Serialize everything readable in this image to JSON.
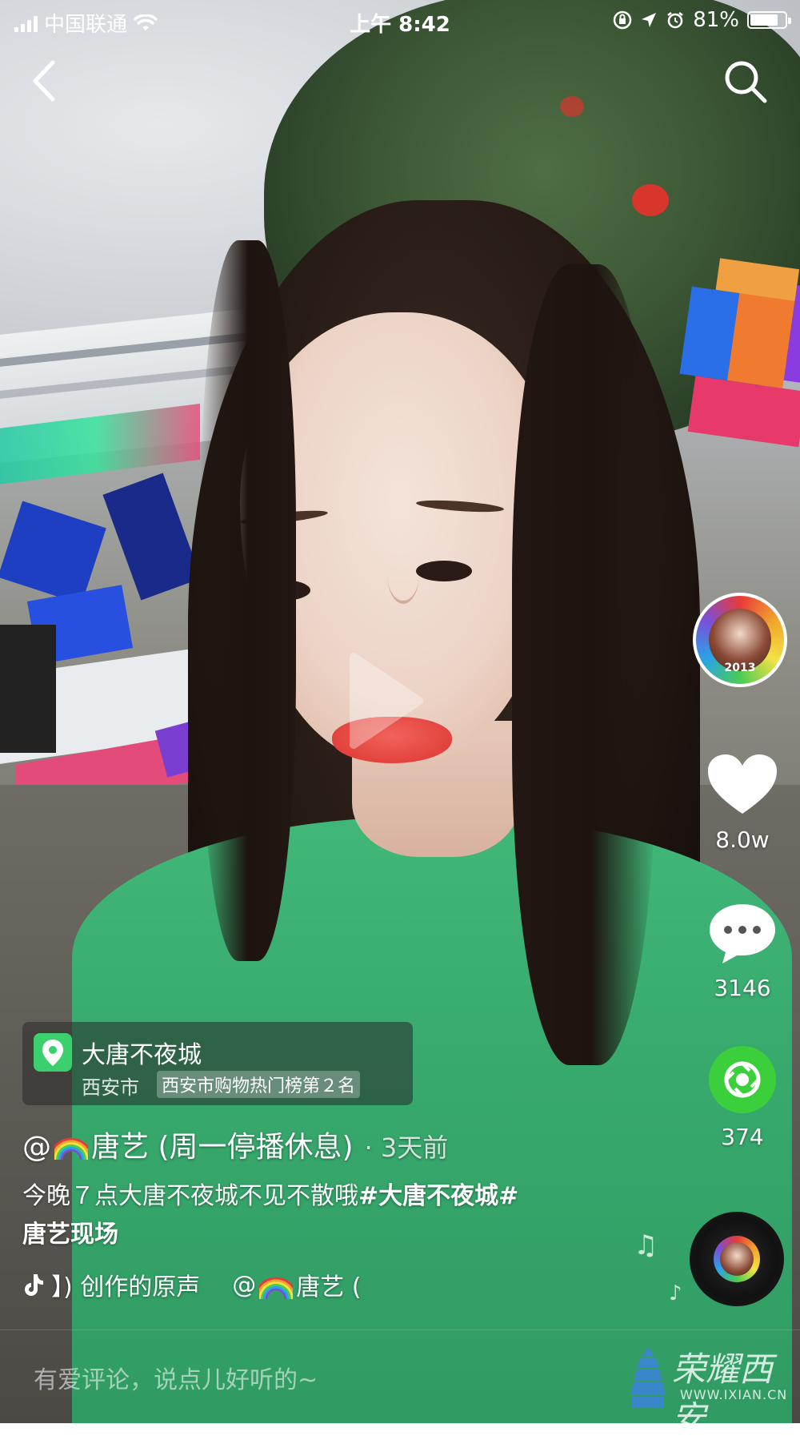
{
  "status_bar": {
    "carrier": "中国联通",
    "time": "上午 8:42",
    "battery_percent": "81%",
    "battery_level": 0.81
  },
  "nav": {
    "back_icon": "chevron-left-icon",
    "search_icon": "search-icon"
  },
  "location": {
    "name": "大唐不夜城",
    "city": "西安市",
    "rank": "西安市购物热门榜第２名",
    "pin_color": "#3ccf6e"
  },
  "post": {
    "author_prefix": "@",
    "author_name": "唐艺 (周一停播休息)",
    "time_ago": "· 3天前",
    "caption_text": "今晚７点大唐不夜城不见不散哦",
    "caption_tag1": "#大唐不夜城#",
    "caption_tag2": "唐艺现场"
  },
  "music": {
    "left_text": "】) 创作的原声",
    "right_prefix": "@",
    "right_text": "唐艺 (",
    "icon": "tiktok-note-icon"
  },
  "actions": {
    "like_count": "8.0w",
    "comment_count": "3146",
    "share_count": "374",
    "avatar_tag": "2013",
    "share_color": "#3ccf3c"
  },
  "comment": {
    "placeholder": "有爱评论，说点儿好听的~"
  },
  "watermark": {
    "title": "荣耀西安",
    "url": "WWW.IXIAN.CN"
  }
}
